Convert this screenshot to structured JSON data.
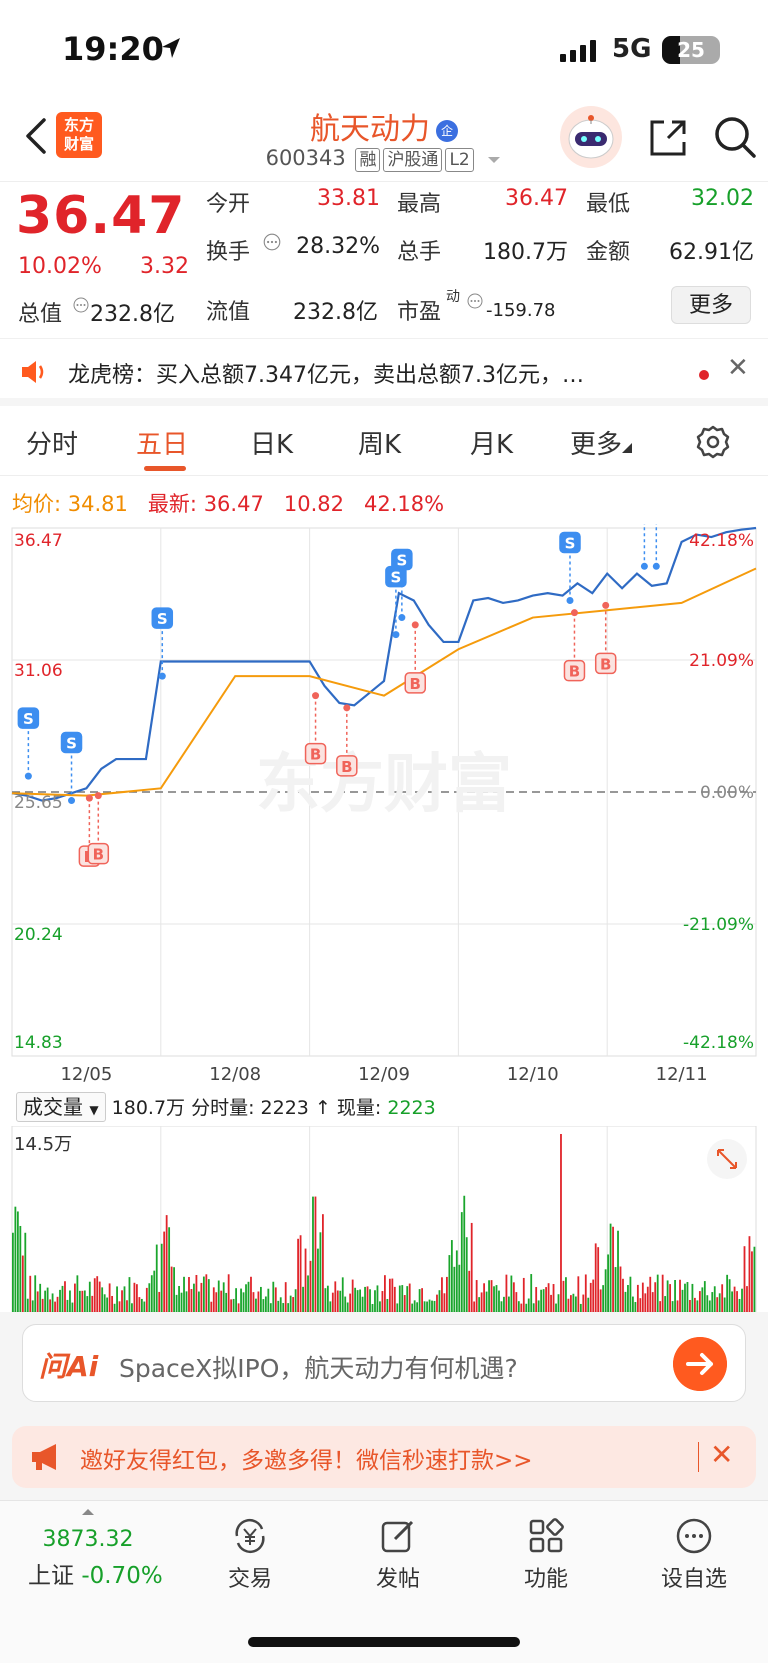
{
  "status_bar": {
    "time": "19:20",
    "network": "5G",
    "battery": "25"
  },
  "header": {
    "logo_text_1": "东方",
    "logo_text_2": "财富",
    "stock_name": "航天动力",
    "qi_badge": "企",
    "stock_code": "600343",
    "tags": [
      "融",
      "沪股通",
      "L2"
    ]
  },
  "quote": {
    "price": "36.47",
    "change_pct": "10.02%",
    "change": "3.32",
    "market_value_label": "总值",
    "market_value": "232.8亿",
    "items": [
      {
        "label": "今开",
        "value": "33.81",
        "color": "red"
      },
      {
        "label": "最高",
        "value": "36.47",
        "color": "red"
      },
      {
        "label": "最低",
        "value": "32.02",
        "color": "green"
      },
      {
        "label": "换手",
        "value": "28.32%",
        "color": "dark"
      },
      {
        "label": "总手",
        "value": "180.7万",
        "color": "dark"
      },
      {
        "label": "金额",
        "value": "62.91亿",
        "color": "dark"
      },
      {
        "label": "流值",
        "value": "232.8亿",
        "color": "dark"
      },
      {
        "label": "市盈",
        "value": "-159.78",
        "color": "dark"
      }
    ],
    "pe_superscript": "动",
    "more_label": "更多"
  },
  "billboard": {
    "text": "龙虎榜：买入总额7.347亿元，卖出总额7.3亿元，…"
  },
  "tabs": [
    {
      "label": "分时",
      "active": false
    },
    {
      "label": "五日",
      "active": true
    },
    {
      "label": "日K",
      "active": false
    },
    {
      "label": "周K",
      "active": false
    },
    {
      "label": "月K",
      "active": false
    },
    {
      "label": "更多",
      "active": false
    }
  ],
  "info_line": {
    "avg_label": "均价:",
    "avg_value": "34.81",
    "latest_label": "最新:",
    "latest_value": "36.47",
    "change": "10.82",
    "change_pct": "42.18%"
  },
  "chart_data": {
    "type": "line",
    "title": "",
    "x_labels": [
      "12/05",
      "12/08",
      "12/09",
      "12/10",
      "12/11"
    ],
    "y_left_ticks": [
      "36.47",
      "31.06",
      "25.65",
      "20.24",
      "14.83"
    ],
    "y_right_ticks": [
      "42.18%",
      "21.09%",
      "0.00%",
      "-21.09%",
      "-42.18%"
    ],
    "ylim": [
      14.83,
      36.47
    ],
    "base_price": 25.65,
    "series": [
      {
        "x": [
          0,
          0.1,
          0.2,
          0.3,
          0.4,
          0.5,
          0.6,
          0.7,
          0.8,
          0.9,
          1.0,
          1.1,
          1.2,
          1.3,
          1.4,
          1.5,
          1.6,
          1.7,
          1.8,
          1.9,
          2.0,
          2.1,
          2.2,
          2.3,
          2.4,
          2.5,
          2.6,
          2.7,
          2.8,
          2.9,
          3.0,
          3.1,
          3.2,
          3.3,
          3.4,
          3.5,
          3.6,
          3.7,
          3.8,
          3.9,
          4.0,
          4.1,
          4.2,
          4.3,
          4.4,
          4.5,
          4.6,
          4.7,
          4.8,
          4.9,
          5.0
        ],
        "y": [
          25.6,
          25.5,
          25.3,
          25.4,
          25.6,
          25.8,
          26.6,
          27.0,
          27.0,
          27.0,
          31.0,
          31.0,
          31.0,
          31.0,
          31.0,
          31.0,
          31.0,
          31.0,
          31.0,
          31.0,
          31.0,
          30.0,
          29.3,
          29.2,
          29.7,
          30.2,
          33.8,
          33.5,
          32.5,
          31.8,
          31.8,
          33.5,
          33.6,
          33.4,
          33.5,
          33.7,
          33.8,
          33.7,
          34.2,
          33.8,
          34.6,
          34.0,
          34.6,
          34.1,
          34.2,
          35.9,
          36.2,
          36.1,
          36.3,
          36.4,
          36.47
        ]
      },
      {
        "x": [
          0,
          0.5,
          1.0,
          1.5,
          2.0,
          2.5,
          3.0,
          3.5,
          4.0,
          4.5,
          5.0
        ],
        "y": [
          25.6,
          25.5,
          25.8,
          30.4,
          30.4,
          29.6,
          31.5,
          32.8,
          33.1,
          33.4,
          34.81
        ]
      }
    ],
    "markers": [
      {
        "type": "S",
        "x": 0.11,
        "y": 26.3
      },
      {
        "type": "S",
        "x": 0.4,
        "y": 25.3
      },
      {
        "type": "B",
        "x": 0.52,
        "y": 25.4
      },
      {
        "type": "B",
        "x": 0.58,
        "y": 25.5
      },
      {
        "type": "S",
        "x": 1.01,
        "y": 30.4
      },
      {
        "type": "B",
        "x": 2.04,
        "y": 29.6
      },
      {
        "type": "B",
        "x": 2.25,
        "y": 29.1
      },
      {
        "type": "S",
        "x": 2.58,
        "y": 32.1
      },
      {
        "type": "S",
        "x": 2.62,
        "y": 32.8
      },
      {
        "type": "B",
        "x": 2.71,
        "y": 32.5
      },
      {
        "type": "S",
        "x": 3.75,
        "y": 33.5
      },
      {
        "type": "B",
        "x": 3.78,
        "y": 33.0
      },
      {
        "type": "B",
        "x": 3.99,
        "y": 33.3
      },
      {
        "type": "S",
        "x": 4.25,
        "y": 34.9
      },
      {
        "type": "S",
        "x": 4.33,
        "y": 34.9
      }
    ],
    "watermark": "东方财富",
    "grid": true
  },
  "volume": {
    "select_label": "成交量",
    "total": "180.7万",
    "tick_label": "分时量:",
    "tick_value": "2223",
    "now_label": "现量:",
    "now_value": "2223",
    "max_label": "14.5万"
  },
  "ai_bar": {
    "logo": "问Ai",
    "text": "SpaceX拟IPO，航天动力有何机遇?"
  },
  "promo": {
    "text": "邀好友得红包，多邀多得！微信秒速打款>>"
  },
  "bottom_nav": {
    "index_value": "3873.32",
    "index_name": "上证",
    "index_change": "-0.70%",
    "items": [
      "交易",
      "发帖",
      "功能",
      "设自选"
    ]
  }
}
